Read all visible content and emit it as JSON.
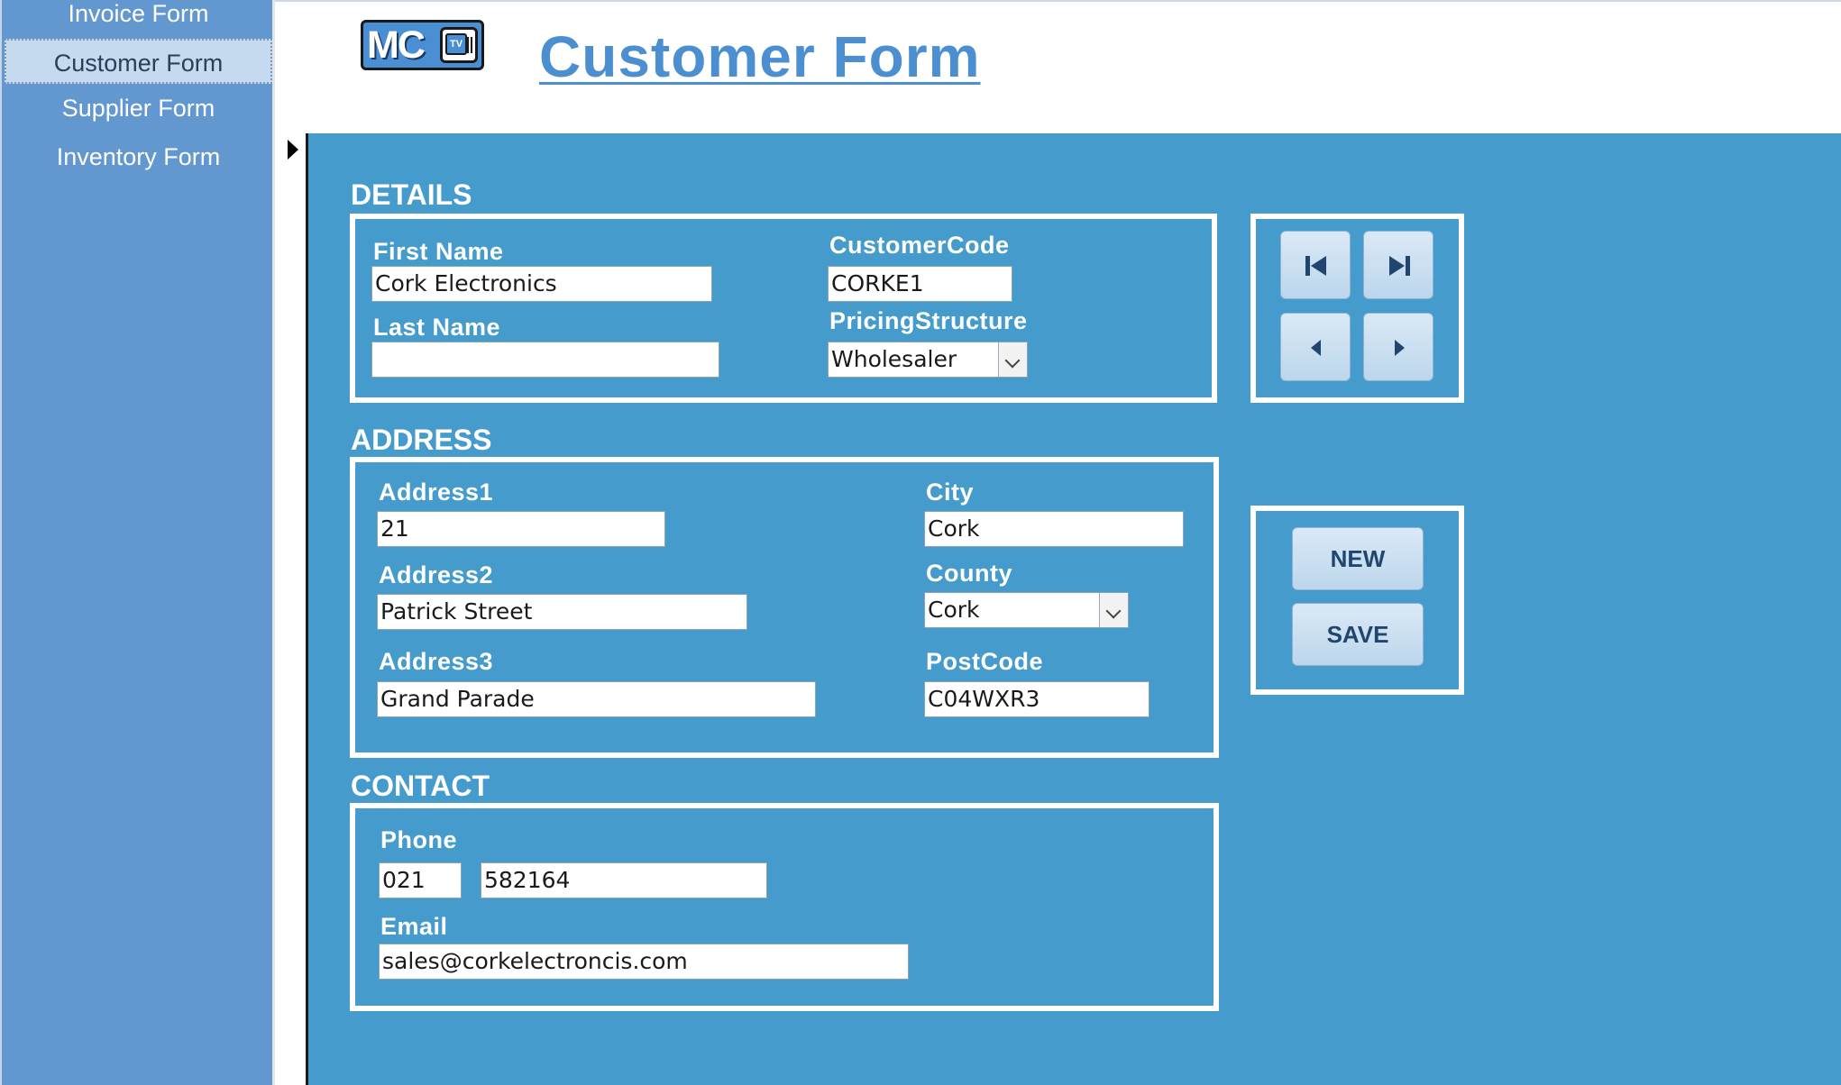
{
  "nav": {
    "items": [
      {
        "label": "Invoice Form"
      },
      {
        "label": "Customer Form"
      },
      {
        "label": "Supplier Form"
      },
      {
        "label": "Inventory Form"
      }
    ],
    "selected": "Customer Form"
  },
  "header": {
    "logo_text": "MC",
    "logo_tv_text": "TV",
    "title": "Customer Form"
  },
  "details": {
    "title": "DETAILS",
    "first_name_label": "First Name",
    "first_name_value": "Cork Electronics",
    "last_name_label": "Last Name",
    "last_name_value": "",
    "customer_code_label": "CustomerCode",
    "customer_code_value": "CORKE1",
    "pricing_label": "PricingStructure",
    "pricing_value": "Wholesaler"
  },
  "address": {
    "title": "ADDRESS",
    "address1_label": "Address1",
    "address1_value": "21",
    "address2_label": "Address2",
    "address2_value": "Patrick Street",
    "address3_label": "Address3",
    "address3_value": "Grand Parade",
    "city_label": "City",
    "city_value": "Cork",
    "county_label": "County",
    "county_value": "Cork",
    "postcode_label": "PostCode",
    "postcode_value": "C04WXR3"
  },
  "contact": {
    "title": "CONTACT",
    "phone_label": "Phone",
    "phone_area_value": "021",
    "phone_number_value": "582164",
    "email_label": "Email",
    "email_value": "sales@corkelectroncis.com"
  },
  "record_nav": {
    "icons": [
      "first-record-icon",
      "last-record-icon",
      "previous-record-icon",
      "next-record-icon"
    ]
  },
  "actions": {
    "new_label": "NEW",
    "save_label": "SAVE"
  },
  "colors": {
    "nav_bg": "#6297cf",
    "nav_selected_bg": "#c5d9ef",
    "form_bg": "#449bcc",
    "title_color": "#4b8fd0",
    "button_text": "#20466f"
  }
}
